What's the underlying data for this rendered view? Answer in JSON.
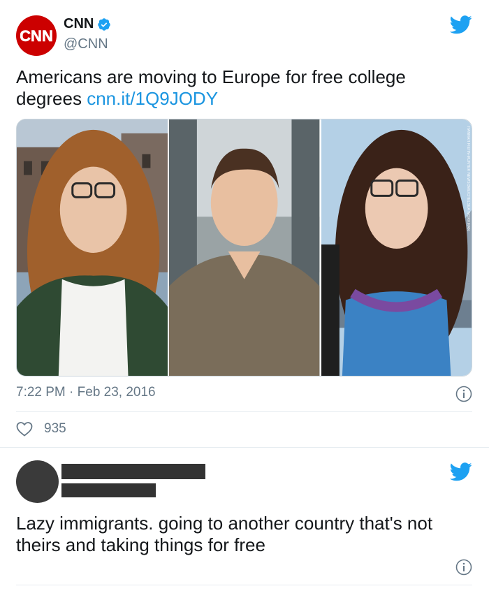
{
  "tweet1": {
    "display_name": "CNN",
    "handle": "@CNN",
    "avatar_logo_text": "CNN",
    "text": "Americans are moving to Europe for free college degrees ",
    "link": "cnn.it/1Q9JODY",
    "photo_credit": "HANNAH FIEHN-MUNTER NEWSOME/CHELSEA WORKMAN",
    "timestamp": "7:22 PM · Feb 23, 2016",
    "like_count": "935"
  },
  "tweet2": {
    "text": "Lazy immigrants. going to another country that's not theirs and taking things for free"
  },
  "icons": {
    "verified": "verified-badge-icon",
    "bird": "twitter-bird-icon",
    "info": "info-icon",
    "heart": "heart-icon"
  },
  "colors": {
    "cnn_red": "#cc0000",
    "twitter_blue": "#1da1f2",
    "link_blue": "#1b95e0",
    "secondary_text": "#657786"
  }
}
